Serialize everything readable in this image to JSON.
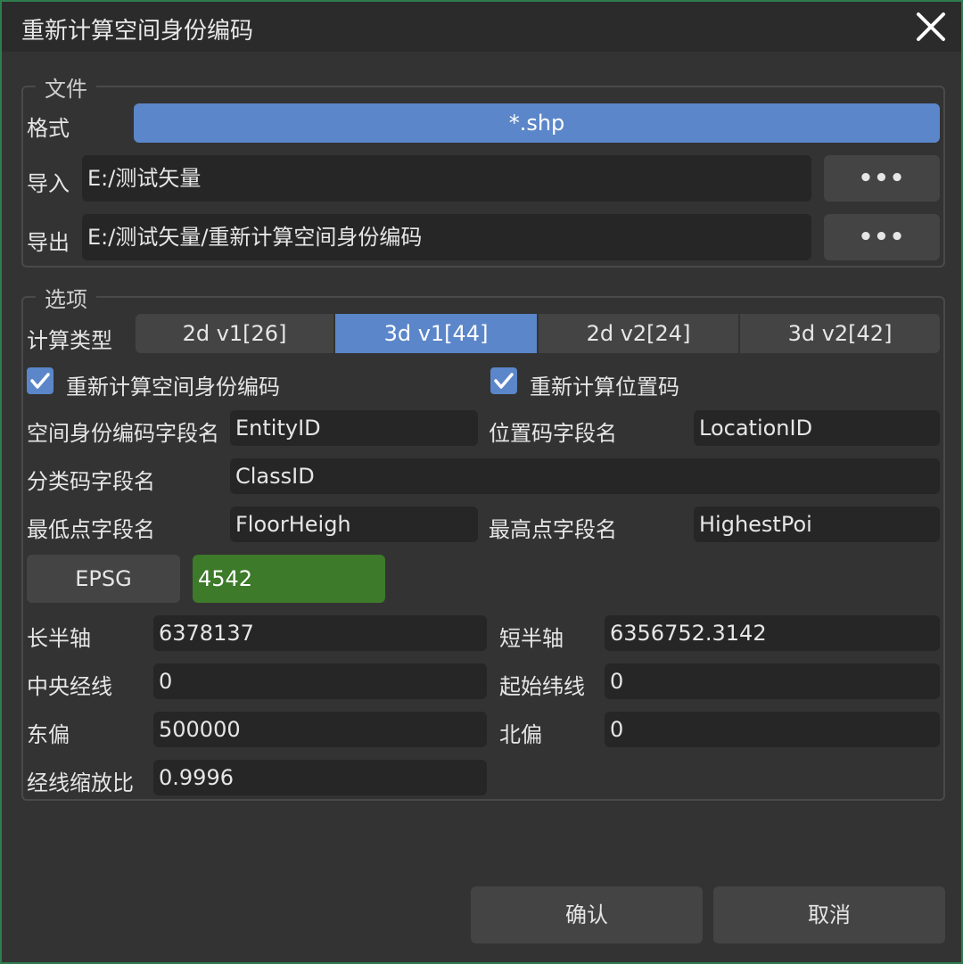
{
  "window": {
    "title": "重新计算空间身份编码"
  },
  "file_group": {
    "legend": "文件",
    "format_label": "格式",
    "format_value": "*.shp",
    "import_label": "导入",
    "import_value": "E:/测试矢量",
    "export_label": "导出",
    "export_value": "E:/测试矢量/重新计算空间身份编码",
    "browse_label": "•••"
  },
  "options_group": {
    "legend": "选项",
    "calc_type_label": "计算类型",
    "calc_types": [
      {
        "label": "2d v1[26]",
        "selected": false
      },
      {
        "label": "3d v1[44]",
        "selected": true
      },
      {
        "label": "2d v2[24]",
        "selected": false
      },
      {
        "label": "3d v2[42]",
        "selected": false
      }
    ],
    "recalc_entity_label": "重新计算空间身份编码",
    "recalc_entity_checked": true,
    "recalc_location_label": "重新计算位置码",
    "recalc_location_checked": true,
    "entity_field_label": "空间身份编码字段名",
    "entity_field_value": "EntityID",
    "location_field_label": "位置码字段名",
    "location_field_value": "LocationID",
    "class_field_label": "分类码字段名",
    "class_field_value": "ClassID",
    "lowest_field_label": "最低点字段名",
    "lowest_field_value": "FloorHeigh",
    "highest_field_label": "最高点字段名",
    "highest_field_value": "HighestPoi",
    "epsg_button": "EPSG",
    "epsg_value": "4542",
    "semi_major_label": "长半轴",
    "semi_major_value": "6378137",
    "semi_minor_label": "短半轴",
    "semi_minor_value": "6356752.3142",
    "central_meridian_label": "中央经线",
    "central_meridian_value": "0",
    "start_latitude_label": "起始纬线",
    "start_latitude_value": "0",
    "false_easting_label": "东偏",
    "false_easting_value": "500000",
    "false_northing_label": "北偏",
    "false_northing_value": "0",
    "scale_factor_label": "经线缩放比",
    "scale_factor_value": "0.9996"
  },
  "footer": {
    "confirm_label": "确认",
    "cancel_label": "取消"
  },
  "colors": {
    "accent": "#5b86c9",
    "epsg_field": "#3d7a2a",
    "window_bg": "#333333",
    "field_bg": "#262626",
    "button_bg": "#444444",
    "border": "#2e7d4f"
  },
  "icons": {
    "close": "close-icon",
    "check": "check-icon"
  }
}
